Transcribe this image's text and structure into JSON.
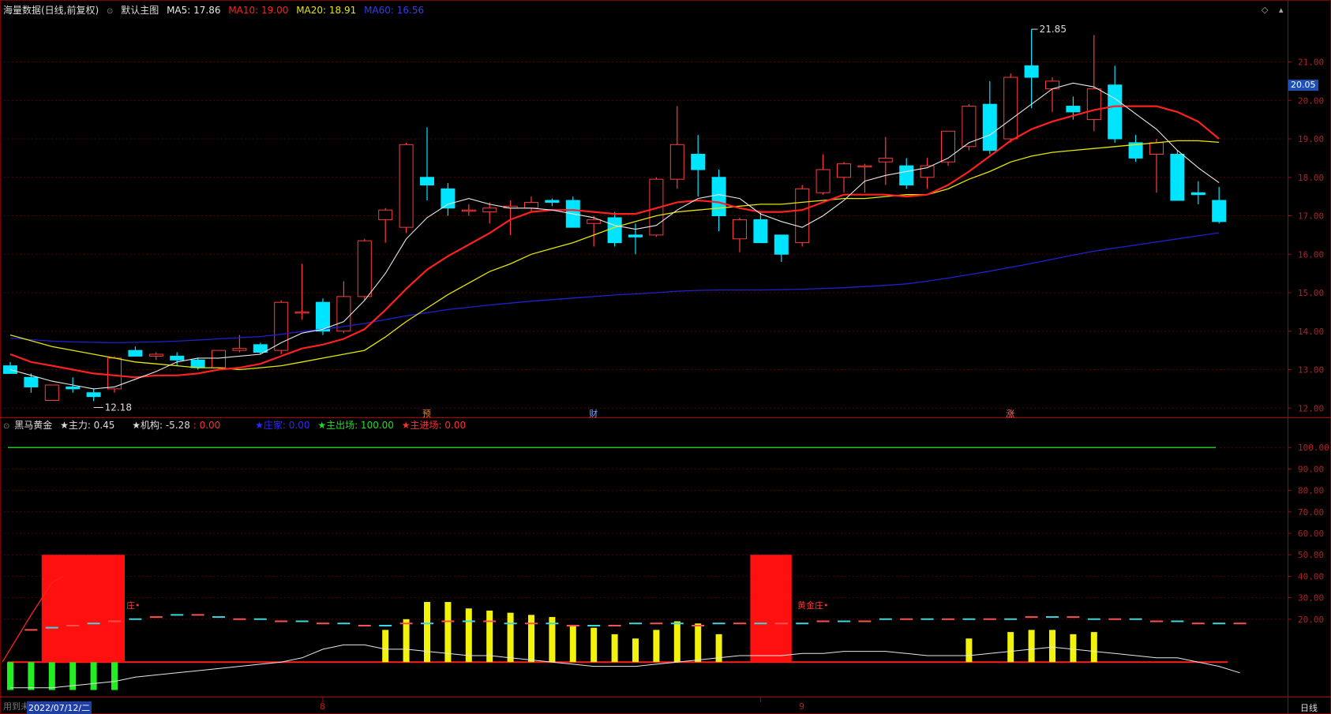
{
  "main_legend": {
    "title": "海量数据(日线,前复权)",
    "chart_name": "默认主图",
    "ma5": "MA5: 17.86",
    "ma10": "MA10: 19.00",
    "ma20": "MA20: 18.91",
    "ma60": "MA60: 16.56"
  },
  "main_markers": {
    "high_label": "21.85",
    "low_label": "12.18",
    "event_1": "预",
    "event_2": "财",
    "event_3": "涨"
  },
  "current_price": "20.05",
  "sub_legend": {
    "title": "黑马黄金",
    "zhuli": "★主力: 0.45",
    "jigou": "★机构: -5.28",
    "jigou_val": ": 0.00",
    "youzi": "★庄家: 0.00",
    "chuchang": "★主出场: 100.00",
    "jinchang": "★主进场: 0.00"
  },
  "sub_annotations": {
    "a1": "庄•",
    "a2": "黄金庄•"
  },
  "bottom_bar": {
    "date": "2022/07/12/二",
    "month_8": "8",
    "month_9": "9",
    "period": "日线",
    "left_hint": "用到未来数据"
  },
  "colors": {
    "up": "#ff3b3b",
    "down": "#00e5ff",
    "ma5": "#e8e8e8",
    "ma10": "#ff2020",
    "ma20": "#e6e600",
    "ma60": "#2020d0",
    "grid": "#5a0000"
  },
  "chart_data": [
    {
      "type": "candlestick",
      "title": "海量数据(日线,前复权)",
      "ylim": [
        11.8,
        22.2
      ],
      "yticks": [
        "21.00",
        "20.00",
        "19.00",
        "18.00",
        "17.00",
        "16.00",
        "15.00",
        "14.00",
        "13.00",
        "12.00"
      ],
      "candles": [
        {
          "o": 13.1,
          "h": 13.2,
          "l": 12.9,
          "c": 12.9
        },
        {
          "o": 12.8,
          "h": 12.9,
          "l": 12.4,
          "c": 12.55
        },
        {
          "o": 12.2,
          "h": 12.6,
          "l": 12.2,
          "c": 12.6
        },
        {
          "o": 12.55,
          "h": 12.8,
          "l": 12.4,
          "c": 12.5
        },
        {
          "o": 12.4,
          "h": 12.5,
          "l": 12.18,
          "c": 12.3
        },
        {
          "o": 12.5,
          "h": 13.35,
          "l": 12.4,
          "c": 13.3
        },
        {
          "o": 13.5,
          "h": 13.6,
          "l": 13.35,
          "c": 13.35
        },
        {
          "o": 13.35,
          "h": 13.45,
          "l": 13.25,
          "c": 13.4
        },
        {
          "o": 13.35,
          "h": 13.45,
          "l": 13.1,
          "c": 13.25
        },
        {
          "o": 13.25,
          "h": 13.3,
          "l": 13.0,
          "c": 13.05
        },
        {
          "o": 13.05,
          "h": 13.5,
          "l": 13.0,
          "c": 13.5
        },
        {
          "o": 13.5,
          "h": 13.9,
          "l": 13.45,
          "c": 13.55
        },
        {
          "o": 13.65,
          "h": 13.7,
          "l": 13.4,
          "c": 13.45
        },
        {
          "o": 13.5,
          "h": 14.8,
          "l": 13.4,
          "c": 14.75
        },
        {
          "o": 14.5,
          "h": 15.75,
          "l": 14.3,
          "c": 14.5
        },
        {
          "o": 14.75,
          "h": 14.85,
          "l": 13.9,
          "c": 14.0
        },
        {
          "o": 14.0,
          "h": 15.3,
          "l": 13.95,
          "c": 14.9
        },
        {
          "o": 14.9,
          "h": 16.4,
          "l": 14.8,
          "c": 16.35
        },
        {
          "o": 16.9,
          "h": 17.2,
          "l": 16.3,
          "c": 17.15
        },
        {
          "o": 16.7,
          "h": 18.9,
          "l": 16.55,
          "c": 18.85
        },
        {
          "o": 18.0,
          "h": 19.3,
          "l": 17.4,
          "c": 17.8
        },
        {
          "o": 17.7,
          "h": 17.85,
          "l": 17.0,
          "c": 17.2
        },
        {
          "o": 17.15,
          "h": 17.3,
          "l": 17.0,
          "c": 17.15
        },
        {
          "o": 17.1,
          "h": 17.35,
          "l": 16.8,
          "c": 17.2
        },
        {
          "o": 17.2,
          "h": 17.4,
          "l": 16.5,
          "c": 17.25
        },
        {
          "o": 17.2,
          "h": 17.5,
          "l": 17.1,
          "c": 17.35
        },
        {
          "o": 17.4,
          "h": 17.45,
          "l": 17.25,
          "c": 17.35
        },
        {
          "o": 17.4,
          "h": 17.5,
          "l": 16.7,
          "c": 16.7
        },
        {
          "o": 16.8,
          "h": 17.0,
          "l": 16.2,
          "c": 16.9
        },
        {
          "o": 16.95,
          "h": 17.1,
          "l": 16.2,
          "c": 16.3
        },
        {
          "o": 16.5,
          "h": 16.8,
          "l": 16.0,
          "c": 16.45
        },
        {
          "o": 16.5,
          "h": 18.0,
          "l": 16.45,
          "c": 17.95
        },
        {
          "o": 17.95,
          "h": 19.85,
          "l": 17.7,
          "c": 18.85
        },
        {
          "o": 18.6,
          "h": 19.1,
          "l": 17.5,
          "c": 18.2
        },
        {
          "o": 18.0,
          "h": 18.2,
          "l": 16.6,
          "c": 17.0
        },
        {
          "o": 16.4,
          "h": 16.95,
          "l": 16.05,
          "c": 16.9
        },
        {
          "o": 16.9,
          "h": 17.1,
          "l": 16.3,
          "c": 16.3
        },
        {
          "o": 16.5,
          "h": 16.5,
          "l": 15.8,
          "c": 16.0
        },
        {
          "o": 16.3,
          "h": 17.8,
          "l": 16.2,
          "c": 17.7
        },
        {
          "o": 17.6,
          "h": 18.6,
          "l": 17.55,
          "c": 18.2
        },
        {
          "o": 18.0,
          "h": 18.4,
          "l": 17.6,
          "c": 18.35
        },
        {
          "o": 18.3,
          "h": 18.35,
          "l": 17.6,
          "c": 18.3
        },
        {
          "o": 18.4,
          "h": 19.05,
          "l": 17.8,
          "c": 18.5
        },
        {
          "o": 18.3,
          "h": 18.5,
          "l": 17.7,
          "c": 17.8
        },
        {
          "o": 18.0,
          "h": 18.5,
          "l": 17.7,
          "c": 18.3
        },
        {
          "o": 18.4,
          "h": 19.2,
          "l": 18.3,
          "c": 19.2
        },
        {
          "o": 18.8,
          "h": 19.9,
          "l": 18.7,
          "c": 19.85
        },
        {
          "o": 19.9,
          "h": 20.5,
          "l": 18.6,
          "c": 18.7
        },
        {
          "o": 19.0,
          "h": 20.7,
          "l": 18.9,
          "c": 20.6
        },
        {
          "o": 20.9,
          "h": 21.85,
          "l": 19.8,
          "c": 20.6
        },
        {
          "o": 20.3,
          "h": 20.6,
          "l": 19.7,
          "c": 20.5
        },
        {
          "o": 19.85,
          "h": 20.1,
          "l": 19.5,
          "c": 19.7
        },
        {
          "o": 19.5,
          "h": 21.7,
          "l": 19.2,
          "c": 20.3
        },
        {
          "o": 20.4,
          "h": 20.9,
          "l": 18.9,
          "c": 19.0
        },
        {
          "o": 18.9,
          "h": 19.1,
          "l": 18.4,
          "c": 18.5
        },
        {
          "o": 18.6,
          "h": 19.0,
          "l": 17.6,
          "c": 18.9
        },
        {
          "o": 18.6,
          "h": 18.7,
          "l": 17.4,
          "c": 17.4
        },
        {
          "o": 17.6,
          "h": 17.9,
          "l": 17.3,
          "c": 17.55
        },
        {
          "o": 17.4,
          "h": 17.75,
          "l": 16.8,
          "c": 16.85
        }
      ],
      "ma5": [
        13.0,
        12.85,
        12.7,
        12.6,
        12.5,
        12.55,
        12.75,
        12.95,
        13.2,
        13.3,
        13.3,
        13.35,
        13.4,
        13.7,
        13.95,
        14.05,
        14.25,
        14.8,
        15.5,
        16.4,
        16.95,
        17.3,
        17.45,
        17.3,
        17.2,
        17.2,
        17.15,
        17.05,
        16.95,
        16.75,
        16.65,
        16.75,
        17.15,
        17.45,
        17.55,
        17.45,
        17.05,
        16.85,
        16.7,
        17.0,
        17.4,
        17.9,
        18.05,
        18.15,
        18.25,
        18.5,
        18.9,
        19.1,
        19.5,
        19.9,
        20.3,
        20.45,
        20.35,
        20.05,
        19.65,
        19.25,
        18.7,
        18.25,
        17.86
      ],
      "ma10": [
        13.4,
        13.2,
        13.1,
        13.0,
        12.9,
        12.85,
        12.8,
        12.85,
        12.85,
        12.9,
        13.0,
        13.05,
        13.15,
        13.35,
        13.55,
        13.65,
        13.8,
        14.05,
        14.55,
        15.1,
        15.6,
        15.95,
        16.25,
        16.55,
        16.9,
        17.1,
        17.15,
        17.15,
        17.1,
        17.05,
        17.05,
        17.2,
        17.35,
        17.4,
        17.35,
        17.2,
        17.1,
        17.1,
        17.15,
        17.35,
        17.55,
        17.55,
        17.55,
        17.5,
        17.55,
        17.8,
        18.15,
        18.55,
        18.95,
        19.25,
        19.45,
        19.6,
        19.75,
        19.85,
        19.85,
        19.85,
        19.7,
        19.45,
        19.0
      ],
      "ma20": [
        13.9,
        13.75,
        13.6,
        13.5,
        13.4,
        13.3,
        13.2,
        13.15,
        13.1,
        13.05,
        13.05,
        13.0,
        13.05,
        13.1,
        13.2,
        13.3,
        13.4,
        13.5,
        13.85,
        14.25,
        14.6,
        14.95,
        15.25,
        15.55,
        15.75,
        16.0,
        16.15,
        16.3,
        16.5,
        16.7,
        16.85,
        17.0,
        17.1,
        17.15,
        17.2,
        17.25,
        17.3,
        17.3,
        17.35,
        17.4,
        17.45,
        17.45,
        17.5,
        17.55,
        17.55,
        17.7,
        17.95,
        18.15,
        18.4,
        18.55,
        18.65,
        18.7,
        18.75,
        18.8,
        18.85,
        18.9,
        18.95,
        18.95,
        18.91
      ],
      "ma60": [
        13.82,
        13.78,
        13.74,
        13.72,
        13.71,
        13.7,
        13.71,
        13.72,
        13.74,
        13.77,
        13.8,
        13.83,
        13.86,
        13.92,
        13.99,
        14.05,
        14.12,
        14.2,
        14.3,
        14.4,
        14.48,
        14.56,
        14.62,
        14.68,
        14.73,
        14.78,
        14.82,
        14.86,
        14.9,
        14.94,
        14.97,
        15.0,
        15.04,
        15.06,
        15.07,
        15.07,
        15.07,
        15.08,
        15.09,
        15.11,
        15.13,
        15.16,
        15.19,
        15.23,
        15.3,
        15.38,
        15.47,
        15.56,
        15.66,
        15.76,
        15.87,
        15.98,
        16.08,
        16.16,
        16.24,
        16.32,
        16.4,
        16.48,
        16.56
      ]
    },
    {
      "type": "bar",
      "title": "黑马黄金",
      "ylim": [
        -15,
        110
      ],
      "yticks": [
        "100.00",
        "90.00",
        "80.00",
        "70.00",
        "60.00",
        "50.00",
        "40.00",
        "30.00",
        "20.00"
      ],
      "exit_line": 100,
      "big_red_blocks": [
        {
          "from": 2,
          "to": 5,
          "top": 50
        },
        {
          "from": 36,
          "to": 37,
          "top": 50
        }
      ],
      "green_bars": [
        0,
        1,
        2,
        3,
        4,
        5
      ],
      "yellow_bars": [
        {
          "i": 18,
          "v": 15
        },
        {
          "i": 19,
          "v": 20
        },
        {
          "i": 20,
          "v": 28
        },
        {
          "i": 21,
          "v": 28
        },
        {
          "i": 22,
          "v": 25
        },
        {
          "i": 23,
          "v": 24
        },
        {
          "i": 24,
          "v": 23
        },
        {
          "i": 25,
          "v": 22
        },
        {
          "i": 26,
          "v": 21
        },
        {
          "i": 27,
          "v": 17
        },
        {
          "i": 28,
          "v": 16
        },
        {
          "i": 29,
          "v": 13
        },
        {
          "i": 30,
          "v": 11
        },
        {
          "i": 31,
          "v": 15
        },
        {
          "i": 32,
          "v": 19
        },
        {
          "i": 33,
          "v": 18
        },
        {
          "i": 34,
          "v": 13
        },
        {
          "i": 46,
          "v": 11
        },
        {
          "i": 48,
          "v": 14
        },
        {
          "i": 49,
          "v": 15
        },
        {
          "i": 50,
          "v": 15
        },
        {
          "i": 51,
          "v": 13
        },
        {
          "i": 52,
          "v": 14
        }
      ],
      "dashes": [
        0,
        15,
        16,
        17,
        18,
        19,
        20,
        21,
        22,
        22,
        21,
        20,
        20,
        19,
        19,
        18,
        18,
        17,
        17,
        18,
        18,
        19,
        19,
        19,
        18,
        18,
        18,
        17,
        17,
        17,
        18,
        18,
        18,
        17,
        18,
        18,
        18,
        18,
        18,
        19,
        19,
        19,
        20,
        20,
        20,
        20,
        20,
        20,
        20,
        21,
        21,
        21,
        20,
        20,
        20,
        19,
        19,
        18,
        18,
        18
      ],
      "white_line": [
        -12,
        -12,
        -12,
        -11,
        -10,
        -9,
        -7,
        -6,
        -5,
        -4,
        -3,
        -2,
        -1,
        0,
        2,
        6,
        8,
        8,
        6,
        6,
        5,
        4,
        3,
        3,
        2,
        1,
        0,
        -1,
        -2,
        -2,
        -2,
        -1,
        0,
        1,
        2,
        3,
        3,
        3,
        4,
        4,
        5,
        5,
        5,
        4,
        3,
        3,
        3,
        4,
        5,
        6,
        7,
        6,
        5,
        4,
        3,
        2,
        2,
        0,
        -2,
        -5
      ]
    }
  ]
}
